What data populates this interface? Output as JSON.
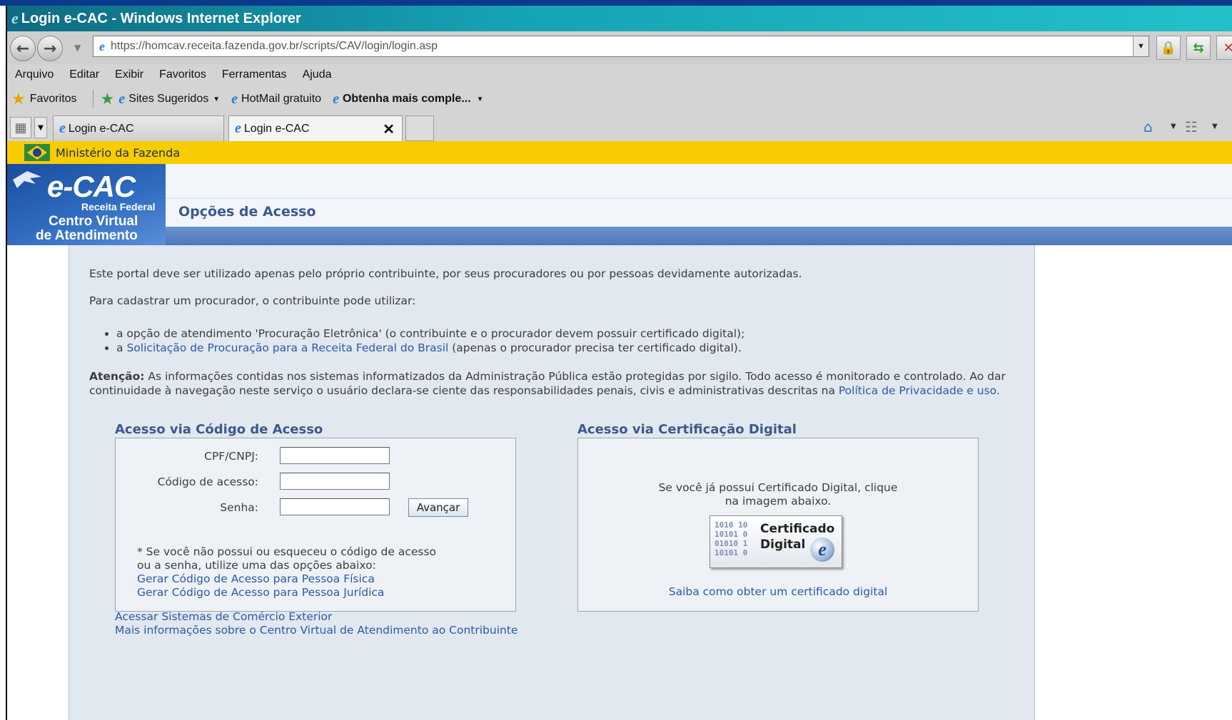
{
  "window": {
    "title": "Login e-CAC - Windows Internet Explorer"
  },
  "address": {
    "url": "https://homcav.receita.fazenda.gov.br/scripts/CAV/login/login.asp"
  },
  "menu": [
    "Arquivo",
    "Editar",
    "Exibir",
    "Favoritos",
    "Ferramentas",
    "Ajuda"
  ],
  "favorites": {
    "label": "Favoritos",
    "sites": "Sites Sugeridos",
    "hotmail": "HotMail gratuito",
    "more": "Obtenha mais comple..."
  },
  "tabs": [
    {
      "label": "Login e-CAC"
    },
    {
      "label": "Login e-CAC"
    }
  ],
  "gov_bar": {
    "text": "Ministério da Fazenda"
  },
  "logo": {
    "ecac": "e-CAC",
    "receita": "Receita Federal",
    "line1": "Centro Virtual",
    "line2": "de Atendimento"
  },
  "page": {
    "title": "Opções de Acesso",
    "intro": "Este portal deve ser utilizado apenas pelo próprio contribuinte, por seus procuradores ou por pessoas devidamente autorizadas.",
    "procurador_intro": "Para cadastrar um procurador, o contribuinte pode utilizar:",
    "bullet1": "a opção de atendimento 'Procuração Eletrônica' (o contribuinte e o procurador devem possuir certificado digital);",
    "bullet2_prefix": "a",
    "bullet2_link": "Solicitação de Procuração para a Receita Federal do Brasil",
    "bullet2_suffix": "(apenas o procurador precisa ter certificado digital).",
    "attention_label": "Atenção:",
    "attention_text": "As informações contidas nos sistemas informatizados da Administração Pública estão protegidas por sigilo. Todo acesso é monitorado e controlado. Ao dar continuidade à navegação neste serviço o usuário declara-se ciente das responsabilidades penais, civis e administrativas descritas na",
    "privacy_link": "Política de Privacidade e uso."
  },
  "code_access": {
    "title": "Acesso via Código de Acesso",
    "cpf_label": "CPF/CNPJ:",
    "code_label": "Código de acesso:",
    "password_label": "Senha:",
    "cpf_value": "",
    "code_value": "",
    "password_value": "",
    "submit": "Avançar",
    "help_line1": "* Se você não possui ou esqueceu o código de acesso",
    "help_line2": "ou a senha, utilize uma das opções abaixo:",
    "link_pf": "Gerar Código de Acesso para Pessoa Física",
    "link_pj": "Gerar Código de Acesso para Pessoa Jurídica"
  },
  "cert_access": {
    "title": "Acesso via Certificação Digital",
    "text1": "Se você já possui Certificado Digital, clique",
    "text2": "na imagem abaixo.",
    "img_line1": "Certificado",
    "img_line2": "Digital",
    "link": "Saiba como obter um certificado digital"
  },
  "footer_links": {
    "comex": "Acessar Sistemas de Comércio Exterior",
    "more_info": "Mais informações sobre o Centro Virtual de Atendimento ao Contribuinte"
  }
}
